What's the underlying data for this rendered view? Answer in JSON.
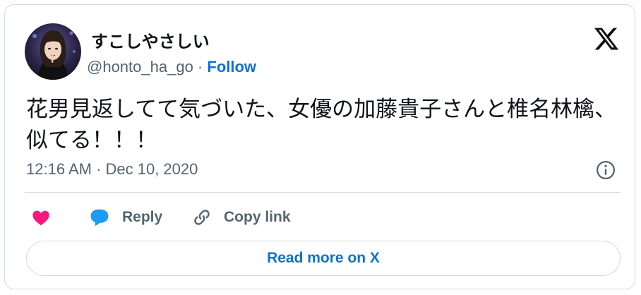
{
  "author": {
    "display_name": "すこしやさしい",
    "handle": "@honto_ha_go",
    "separator": " · ",
    "follow_label": "Follow"
  },
  "tweet": {
    "text": "花男見返してて気づいた、女優の加藤貴子さんと椎名林檎、似てる！！！",
    "timestamp": "12:16 AM · Dec 10, 2020"
  },
  "actions": {
    "reply_label": "Reply",
    "copy_link_label": "Copy link",
    "read_more_label": "Read more on X"
  },
  "icons": {
    "brand": "x-logo-icon",
    "info": "info-icon",
    "like": "heart-icon",
    "reply": "speech-bubble-icon",
    "copy": "link-icon"
  },
  "colors": {
    "link": "#0f72cc",
    "like": "#f91880",
    "reply": "#1d9bf0",
    "secondary_text": "#536471",
    "border": "#cfd9de"
  }
}
